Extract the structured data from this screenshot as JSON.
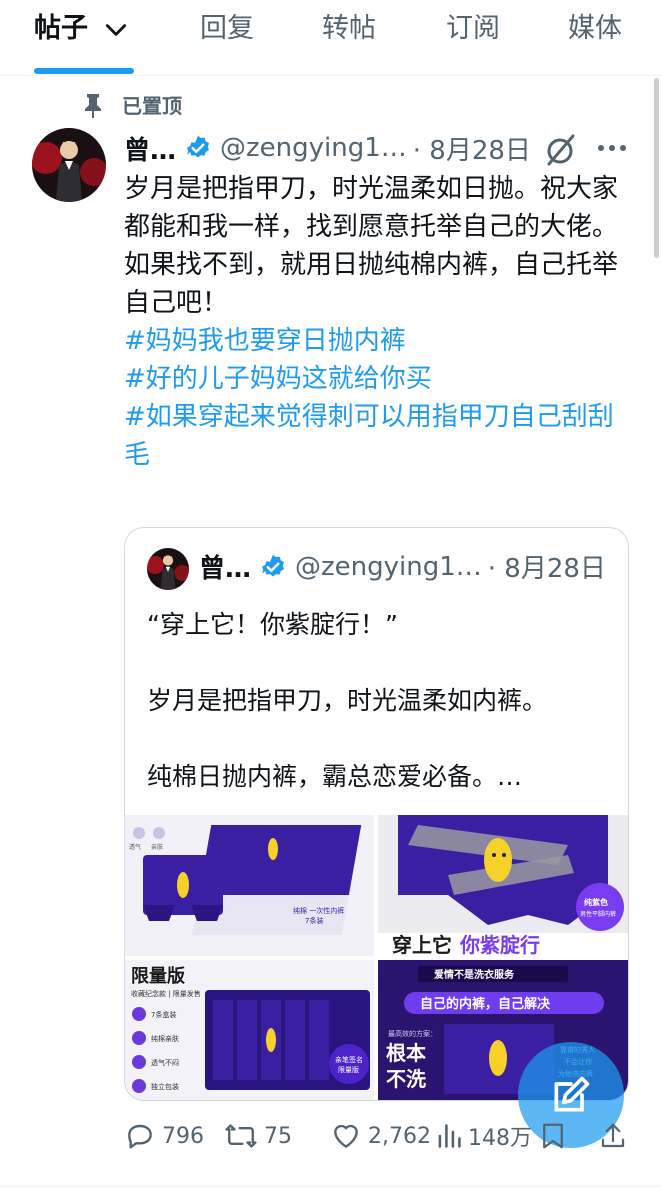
{
  "tabs": [
    {
      "label": "帖子"
    },
    {
      "label": "回复"
    },
    {
      "label": "转帖"
    },
    {
      "label": "订阅"
    },
    {
      "label": "媒体"
    }
  ],
  "pinned_label": "已置顶",
  "post": {
    "name": "曾…",
    "handle": "@zengying1…",
    "date": "· 8月28日",
    "lines": [
      "岁月是把指甲刀，时光温柔如日抛。祝大家都能和我一样，找到愿意托举自己的大佬。",
      "如果找不到，就用日抛纯棉内裤，自己托举自己吧！"
    ],
    "hashtags": [
      "#妈妈我也要穿日抛内裤",
      "#好的儿子妈妈这就给你买",
      "#如果穿起来觉得刺可以用指甲刀自己刮刮毛"
    ]
  },
  "quote": {
    "name": "曾…",
    "handle": "@zengying1…",
    "date": "· 8月28日",
    "paragraphs": [
      "“穿上它！你紫腚行！”",
      "岁月是把指甲刀，时光温柔如内裤。",
      "纯棉日抛内裤，霸总恋爱必备。…"
    ],
    "media": {
      "img1": {
        "box_label": "纯棉\n一次性内裤\n7条装",
        "side1": "透气",
        "side2": "亲肤"
      },
      "img2": {
        "badge": "纯紫色\n男性平脚内裤",
        "banner": "穿上它你紫腚行"
      },
      "img3": {
        "title": "限量版",
        "subtitle": "收藏纪念款 | 限量发售",
        "features": [
          "7条盒装",
          "纯棉亲肤",
          "透气不闷",
          "独立包装"
        ],
        "badge": "亲笔签名\n限量版"
      },
      "img4": {
        "tag": "爱情不是洗衣服务",
        "slogan": "自己的内裤，自己解决",
        "small": "最高效的方案：",
        "big": "根本\n不洗",
        "script": "靠谱的男人\n不会让你\n为他洗内裤"
      }
    }
  },
  "actions": {
    "reply": "796",
    "retweet": "75",
    "like": "2,762",
    "views": "148万"
  },
  "colors": {
    "accent": "#1d9bf0",
    "muted": "#536471",
    "purple": "#3b1fa3"
  }
}
